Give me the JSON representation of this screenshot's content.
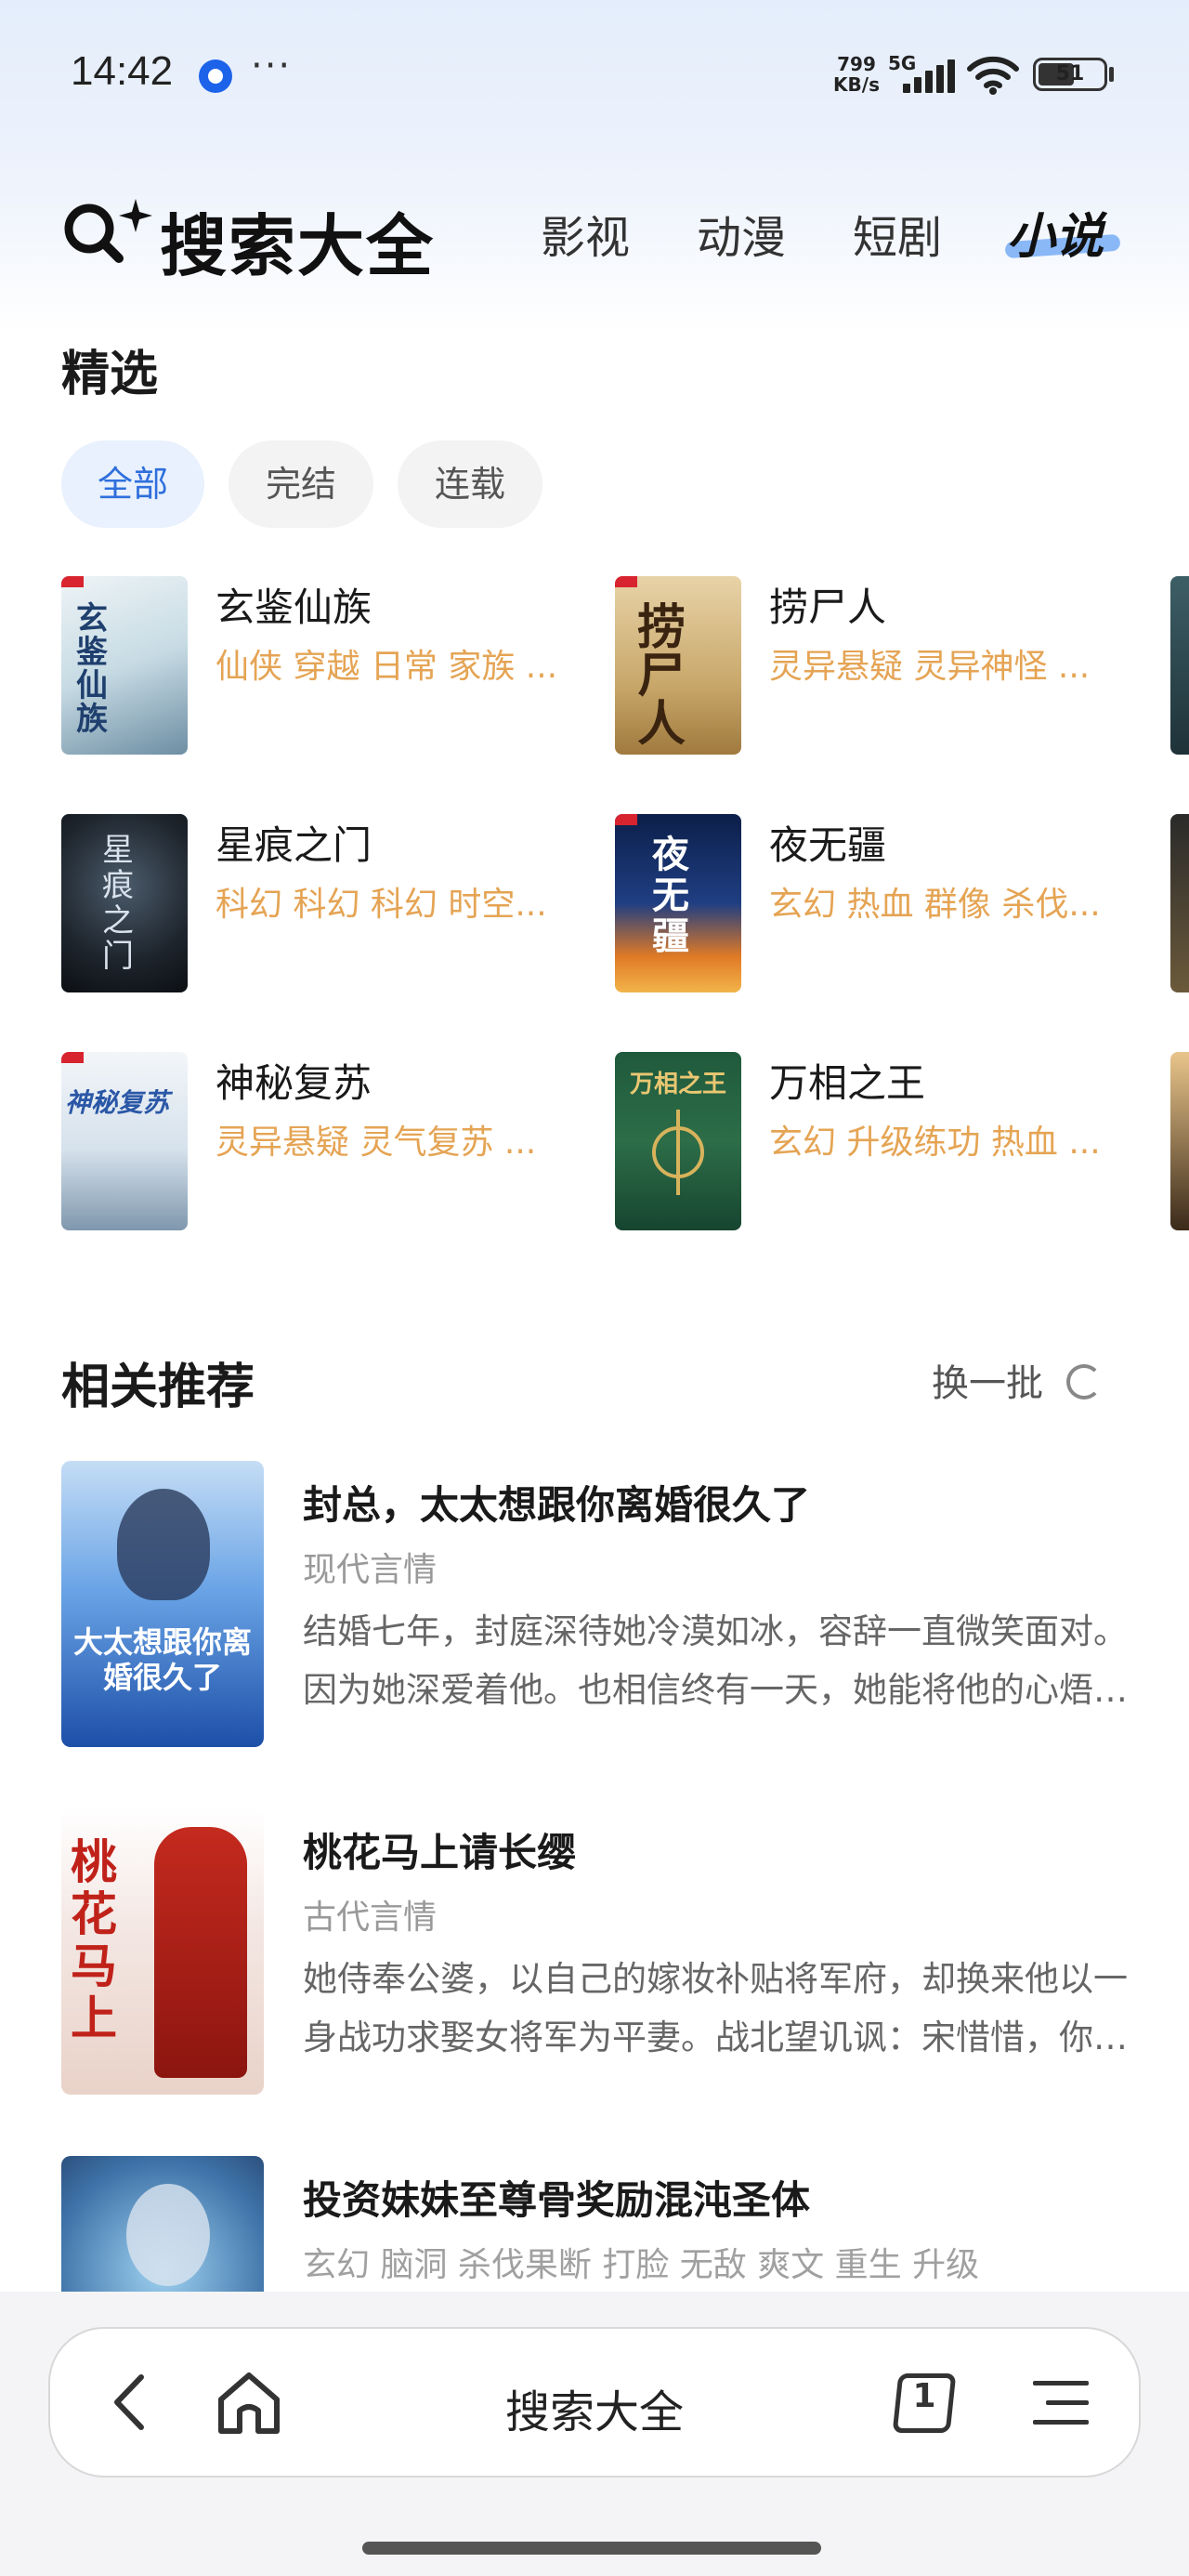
{
  "status_bar": {
    "time": "14:42",
    "network_speed_value": "799",
    "network_speed_unit": "KB/s",
    "network_type": "5G",
    "battery": "51",
    "more_icon": "ellipsis-icon"
  },
  "header": {
    "logo_text": "搜索大全",
    "tabs": [
      "影视",
      "动漫",
      "短剧",
      "小说"
    ],
    "active_tab": "小说"
  },
  "featured": {
    "title": "精选",
    "filters": [
      "全部",
      "完结",
      "连载"
    ],
    "active_filter": "全部",
    "books": [
      {
        "name": "玄鉴仙族",
        "tags": "仙侠 穿越 日常 家族 ...",
        "cover_text": "玄鉴仙族"
      },
      {
        "name": "捞尸人",
        "tags": "灵异悬疑 灵异神怪 ...",
        "cover_text": "捞尸人"
      },
      {
        "name": "星痕之门",
        "tags": "科幻 科幻 科幻 时空...",
        "cover_text": "星痕之门"
      },
      {
        "name": "夜无疆",
        "tags": "玄幻 热血 群像 杀伐...",
        "cover_text": "夜无疆"
      },
      {
        "name": "神秘复苏",
        "tags": "灵异悬疑 灵气复苏 ...",
        "cover_text": "神秘复苏"
      },
      {
        "name": "万相之王",
        "tags": "玄幻 升级练功 热血 ...",
        "cover_text": "万相之王"
      }
    ]
  },
  "recommend": {
    "title": "相关推荐",
    "refresh_label": "换一批",
    "items": [
      {
        "title": "封总，太太想跟你离婚很久了",
        "genre": "现代言情",
        "desc": "结婚七年，封庭深待她冷漠如冰，容辞一直微笑面对。因为她深爱着他。也相信终有一天，她能将他的心焐热。但她等来了他对另一个女人的一见钟情。",
        "cover_text": "大太想跟你离婚很久了"
      },
      {
        "title": "桃花马上请长缨",
        "genre": "古代言情",
        "desc": "她侍奉公婆，以自己的嫁妆补贴将军府，却换来他以一身战功求娶女将军为平妻。战北望讥讽：宋惜惜，你除了会些内宅功夫，还会什么？",
        "cover_text": "桃花马上"
      },
      {
        "title": "投资妹妹至尊骨奖励混沌圣体",
        "genre": "玄幻 脑洞 杀伐果断 打脸 无敌 爽文 重生 升级",
        "desc": "",
        "cover_text": ""
      }
    ]
  },
  "bottom_bar": {
    "title": "搜索大全",
    "tab_count": "1",
    "back_icon": "back-icon",
    "home_icon": "home-icon",
    "menu_icon": "menu-icon"
  },
  "colors": {
    "accent": "#2f6fdc",
    "tag_orange": "#e5a454",
    "header_gradient": "#e4edfb"
  }
}
